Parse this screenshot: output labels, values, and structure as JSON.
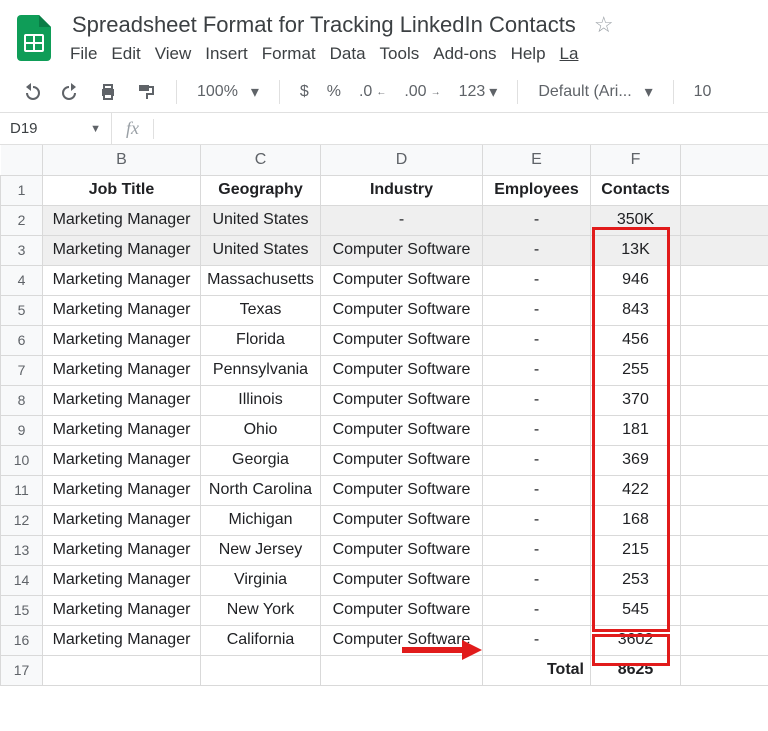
{
  "doc_title": "Spreadsheet Format for Tracking LinkedIn Contacts",
  "menus": [
    "File",
    "Edit",
    "View",
    "Insert",
    "Format",
    "Data",
    "Tools",
    "Add-ons",
    "Help",
    "La"
  ],
  "toolbar": {
    "zoom": "100%",
    "font": "Default (Ari...",
    "fontsize": "10",
    "currency": "$",
    "percent": "%",
    "numfmt": "123"
  },
  "namebox": "D19",
  "fx_label": "fx",
  "col_letters": [
    "",
    "B",
    "C",
    "D",
    "E",
    "F",
    ""
  ],
  "headers": {
    "B": "Job Title",
    "C": "Geography",
    "D": "Industry",
    "E": "Employees",
    "F": "Contacts"
  },
  "rows": [
    {
      "n": 2,
      "shade": true,
      "B": "Marketing Manager",
      "C": "United States",
      "D": "-",
      "E": "-",
      "F": "350K"
    },
    {
      "n": 3,
      "shade": true,
      "B": "Marketing Manager",
      "C": "United States",
      "D": "Computer Software",
      "E": "-",
      "F": "13K"
    },
    {
      "n": 4,
      "B": "Marketing Manager",
      "C": "Massachusetts",
      "D": "Computer Software",
      "E": "-",
      "F": "946"
    },
    {
      "n": 5,
      "B": "Marketing Manager",
      "C": "Texas",
      "D": "Computer Software",
      "E": "-",
      "F": "843"
    },
    {
      "n": 6,
      "B": "Marketing Manager",
      "C": "Florida",
      "D": "Computer Software",
      "E": "-",
      "F": "456"
    },
    {
      "n": 7,
      "B": "Marketing Manager",
      "C": "Pennsylvania",
      "D": "Computer Software",
      "E": "-",
      "F": "255"
    },
    {
      "n": 8,
      "B": "Marketing Manager",
      "C": "Illinois",
      "D": "Computer Software",
      "E": "-",
      "F": "370"
    },
    {
      "n": 9,
      "B": "Marketing Manager",
      "C": "Ohio",
      "D": "Computer Software",
      "E": "-",
      "F": "181"
    },
    {
      "n": 10,
      "B": "Marketing Manager",
      "C": "Georgia",
      "D": "Computer Software",
      "E": "-",
      "F": "369"
    },
    {
      "n": 11,
      "B": "Marketing Manager",
      "C": "North Carolina",
      "D": "Computer Software",
      "E": "-",
      "F": "422"
    },
    {
      "n": 12,
      "B": "Marketing Manager",
      "C": "Michigan",
      "D": "Computer Software",
      "E": "-",
      "F": "168"
    },
    {
      "n": 13,
      "B": "Marketing Manager",
      "C": "New Jersey",
      "D": "Computer Software",
      "E": "-",
      "F": "215"
    },
    {
      "n": 14,
      "B": "Marketing Manager",
      "C": "Virginia",
      "D": "Computer Software",
      "E": "-",
      "F": "253"
    },
    {
      "n": 15,
      "B": "Marketing Manager",
      "C": "New York",
      "D": "Computer Software",
      "E": "-",
      "F": "545"
    },
    {
      "n": 16,
      "B": "Marketing Manager",
      "C": "California",
      "D": "Computer Software",
      "E": "-",
      "F": "3602"
    }
  ],
  "total": {
    "label": "Total",
    "value": "8625",
    "n": 17
  }
}
